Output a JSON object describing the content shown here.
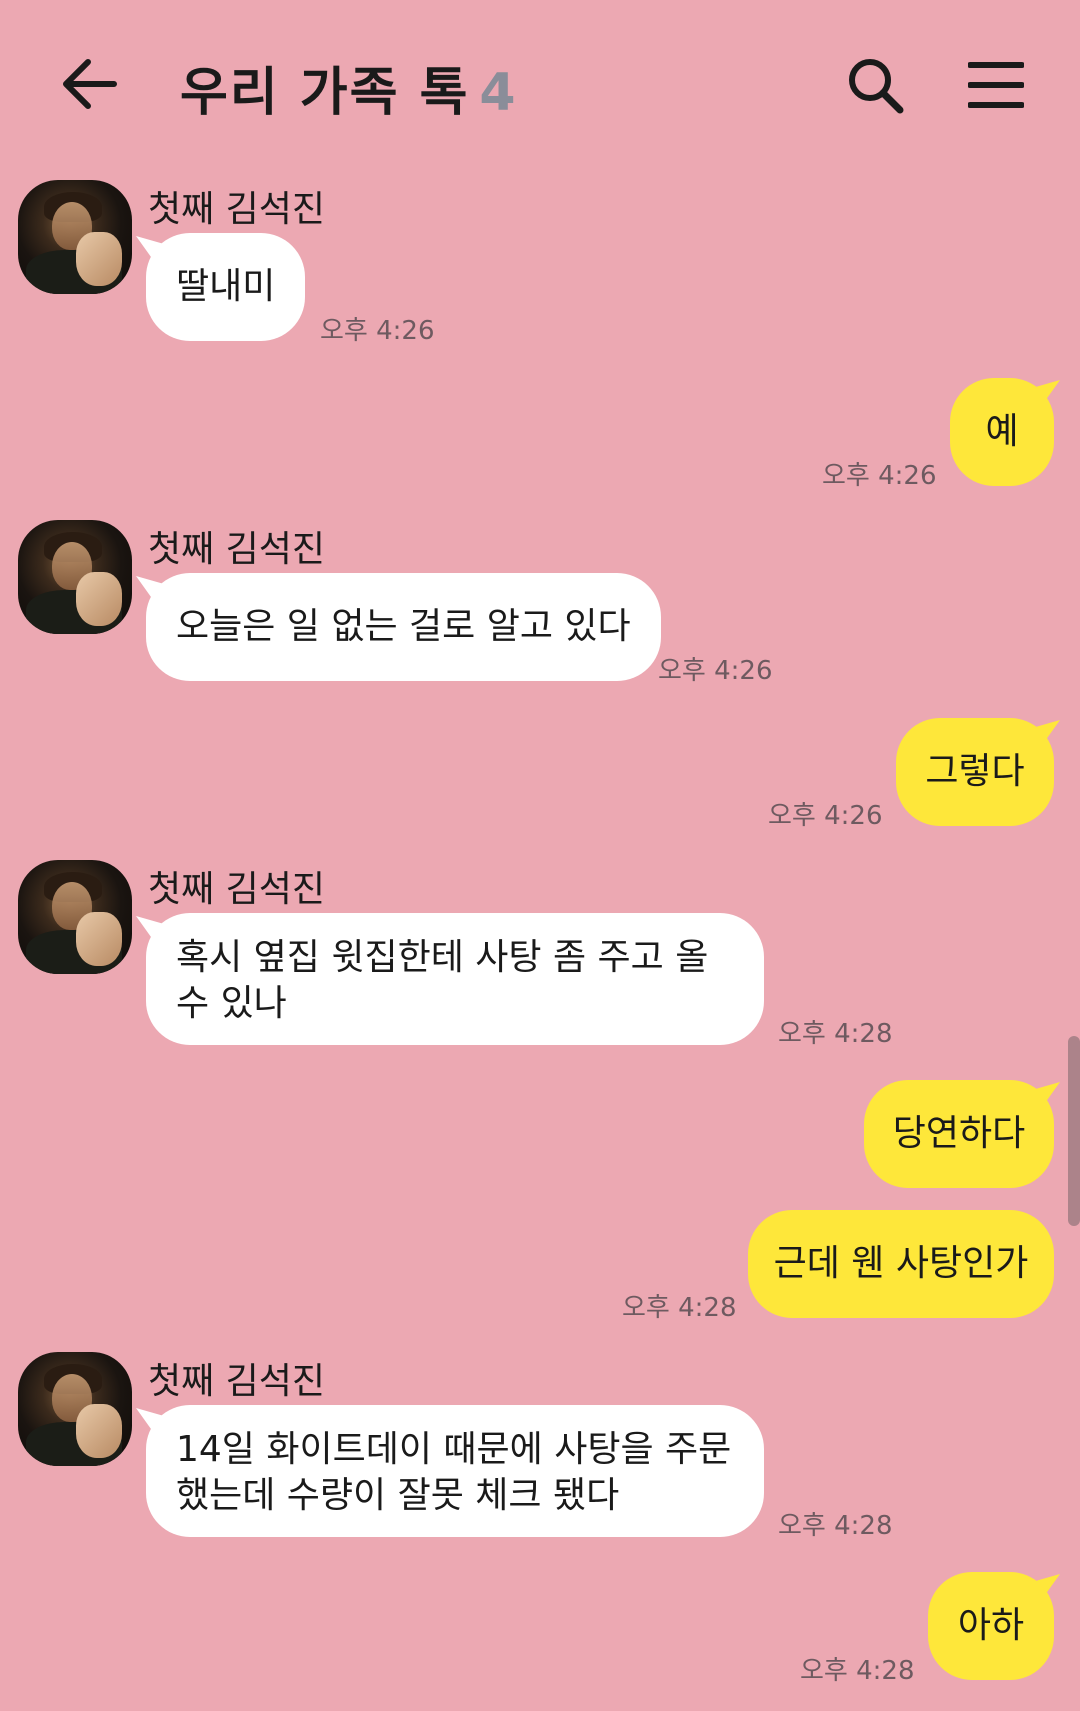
{
  "header": {
    "title": "우리 가족 톡",
    "member_count": "4",
    "back_icon": "arrow-left-icon",
    "search_icon": "search-icon",
    "menu_icon": "hamburger-menu-icon"
  },
  "colors": {
    "background": "#eca8b2",
    "incoming_bubble": "#ffffff",
    "outgoing_bubble": "#fee73a",
    "time_text": "#6e5a60"
  },
  "messages": [
    {
      "direction": "incoming",
      "sender": "첫째 김석진",
      "text": "딸내미",
      "time": "오후 4:26"
    },
    {
      "direction": "outgoing",
      "text": "예",
      "time": "오후 4:26"
    },
    {
      "direction": "incoming",
      "sender": "첫째 김석진",
      "text": "오늘은 일 없는 걸로 알고 있다",
      "time": "오후 4:26"
    },
    {
      "direction": "outgoing",
      "text": "그렇다",
      "time": "오후 4:26"
    },
    {
      "direction": "incoming",
      "sender": "첫째 김석진",
      "text": "혹시 옆집 윗집한테 사탕 좀 주고 올 수 있나",
      "time": "오후 4:28"
    },
    {
      "direction": "outgoing",
      "text": "당연하다",
      "time": ""
    },
    {
      "direction": "outgoing",
      "text": "근데 웬 사탕인가",
      "time": "오후 4:28"
    },
    {
      "direction": "incoming",
      "sender": "첫째 김석진",
      "text": "14일 화이트데이 때문에 사탕을 주문했는데 수량이 잘못 체크 됐다",
      "time": "오후 4:28"
    },
    {
      "direction": "outgoing",
      "text": "아하",
      "time": "오후 4:28"
    }
  ]
}
